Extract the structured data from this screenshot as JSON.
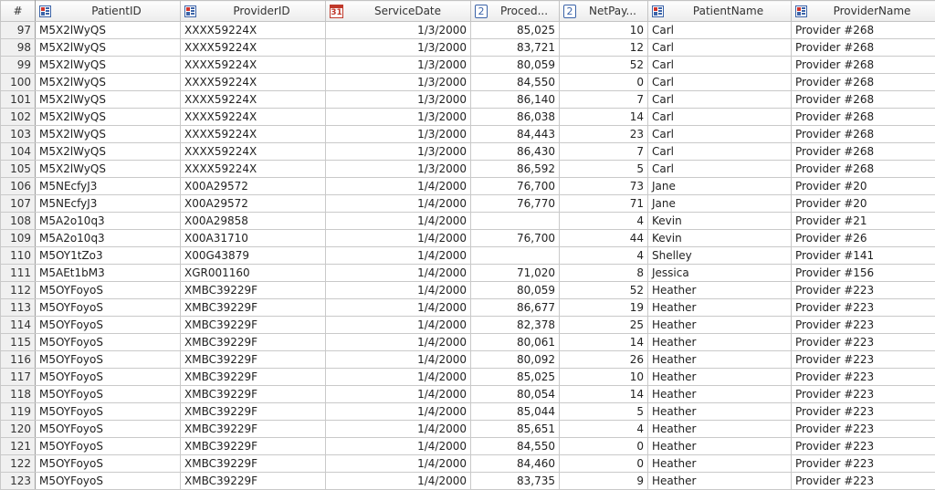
{
  "columns": [
    {
      "key": "rownum",
      "label": "#",
      "icon": "",
      "icon_name": "",
      "align": "right",
      "width": 38
    },
    {
      "key": "patient_id",
      "label": "PatientID",
      "icon": "table",
      "icon_name": "table-icon",
      "align": "left",
      "width": 159
    },
    {
      "key": "provider_id",
      "label": "ProviderID",
      "icon": "table",
      "icon_name": "table-icon",
      "align": "left",
      "width": 159
    },
    {
      "key": "service_date",
      "label": "ServiceDate",
      "icon": "cal",
      "icon_glyph": "31",
      "icon_name": "calendar-icon",
      "align": "right",
      "width": 159
    },
    {
      "key": "proced",
      "label": "Proced...",
      "icon": "num",
      "icon_glyph": "2",
      "icon_name": "numeric-icon",
      "align": "right",
      "width": 97
    },
    {
      "key": "net_pay",
      "label": "NetPay...",
      "icon": "num",
      "icon_glyph": "2",
      "icon_name": "numeric-icon",
      "align": "right",
      "width": 97
    },
    {
      "key": "patient_name",
      "label": "PatientName",
      "icon": "table",
      "icon_name": "table-icon",
      "align": "left",
      "width": 157
    },
    {
      "key": "provider_name",
      "label": "ProviderName",
      "icon": "table",
      "icon_name": "table-icon",
      "align": "left",
      "width": 158
    }
  ],
  "rows": [
    [
      "97",
      "M5X2lWyQS",
      "XXXX59224X",
      "1/3/2000",
      "85,025",
      "10",
      "Carl",
      "Provider #268"
    ],
    [
      "98",
      "M5X2lWyQS",
      "XXXX59224X",
      "1/3/2000",
      "83,721",
      "12",
      "Carl",
      "Provider #268"
    ],
    [
      "99",
      "M5X2lWyQS",
      "XXXX59224X",
      "1/3/2000",
      "80,059",
      "52",
      "Carl",
      "Provider #268"
    ],
    [
      "100",
      "M5X2lWyQS",
      "XXXX59224X",
      "1/3/2000",
      "84,550",
      "0",
      "Carl",
      "Provider #268"
    ],
    [
      "101",
      "M5X2lWyQS",
      "XXXX59224X",
      "1/3/2000",
      "86,140",
      "7",
      "Carl",
      "Provider #268"
    ],
    [
      "102",
      "M5X2lWyQS",
      "XXXX59224X",
      "1/3/2000",
      "86,038",
      "14",
      "Carl",
      "Provider #268"
    ],
    [
      "103",
      "M5X2lWyQS",
      "XXXX59224X",
      "1/3/2000",
      "84,443",
      "23",
      "Carl",
      "Provider #268"
    ],
    [
      "104",
      "M5X2lWyQS",
      "XXXX59224X",
      "1/3/2000",
      "86,430",
      "7",
      "Carl",
      "Provider #268"
    ],
    [
      "105",
      "M5X2lWyQS",
      "XXXX59224X",
      "1/3/2000",
      "86,592",
      "5",
      "Carl",
      "Provider #268"
    ],
    [
      "106",
      "M5NEcfyJ3",
      "X00A29572",
      "1/4/2000",
      "76,700",
      "73",
      "Jane",
      "Provider #20"
    ],
    [
      "107",
      "M5NEcfyJ3",
      "X00A29572",
      "1/4/2000",
      "76,770",
      "71",
      "Jane",
      "Provider #20"
    ],
    [
      "108",
      "M5A2o10q3",
      "X00A29858",
      "1/4/2000",
      "",
      "4",
      "Kevin",
      "Provider #21"
    ],
    [
      "109",
      "M5A2o10q3",
      "X00A31710",
      "1/4/2000",
      "76,700",
      "44",
      "Kevin",
      "Provider #26"
    ],
    [
      "110",
      "M5OY1tZo3",
      "X00G43879",
      "1/4/2000",
      "",
      "4",
      "Shelley",
      "Provider #141"
    ],
    [
      "111",
      "M5AEt1bM3",
      "XGR001160",
      "1/4/2000",
      "71,020",
      "8",
      "Jessica",
      "Provider #156"
    ],
    [
      "112",
      "M5OYFoyoS",
      "XMBC39229F",
      "1/4/2000",
      "80,059",
      "52",
      "Heather",
      "Provider #223"
    ],
    [
      "113",
      "M5OYFoyoS",
      "XMBC39229F",
      "1/4/2000",
      "86,677",
      "19",
      "Heather",
      "Provider #223"
    ],
    [
      "114",
      "M5OYFoyoS",
      "XMBC39229F",
      "1/4/2000",
      "82,378",
      "25",
      "Heather",
      "Provider #223"
    ],
    [
      "115",
      "M5OYFoyoS",
      "XMBC39229F",
      "1/4/2000",
      "80,061",
      "14",
      "Heather",
      "Provider #223"
    ],
    [
      "116",
      "M5OYFoyoS",
      "XMBC39229F",
      "1/4/2000",
      "80,092",
      "26",
      "Heather",
      "Provider #223"
    ],
    [
      "117",
      "M5OYFoyoS",
      "XMBC39229F",
      "1/4/2000",
      "85,025",
      "10",
      "Heather",
      "Provider #223"
    ],
    [
      "118",
      "M5OYFoyoS",
      "XMBC39229F",
      "1/4/2000",
      "80,054",
      "14",
      "Heather",
      "Provider #223"
    ],
    [
      "119",
      "M5OYFoyoS",
      "XMBC39229F",
      "1/4/2000",
      "85,044",
      "5",
      "Heather",
      "Provider #223"
    ],
    [
      "120",
      "M5OYFoyoS",
      "XMBC39229F",
      "1/4/2000",
      "85,651",
      "4",
      "Heather",
      "Provider #223"
    ],
    [
      "121",
      "M5OYFoyoS",
      "XMBC39229F",
      "1/4/2000",
      "84,550",
      "0",
      "Heather",
      "Provider #223"
    ],
    [
      "122",
      "M5OYFoyoS",
      "XMBC39229F",
      "1/4/2000",
      "84,460",
      "0",
      "Heather",
      "Provider #223"
    ],
    [
      "123",
      "M5OYFoyoS",
      "XMBC39229F",
      "1/4/2000",
      "83,735",
      "9",
      "Heather",
      "Provider #223"
    ]
  ]
}
